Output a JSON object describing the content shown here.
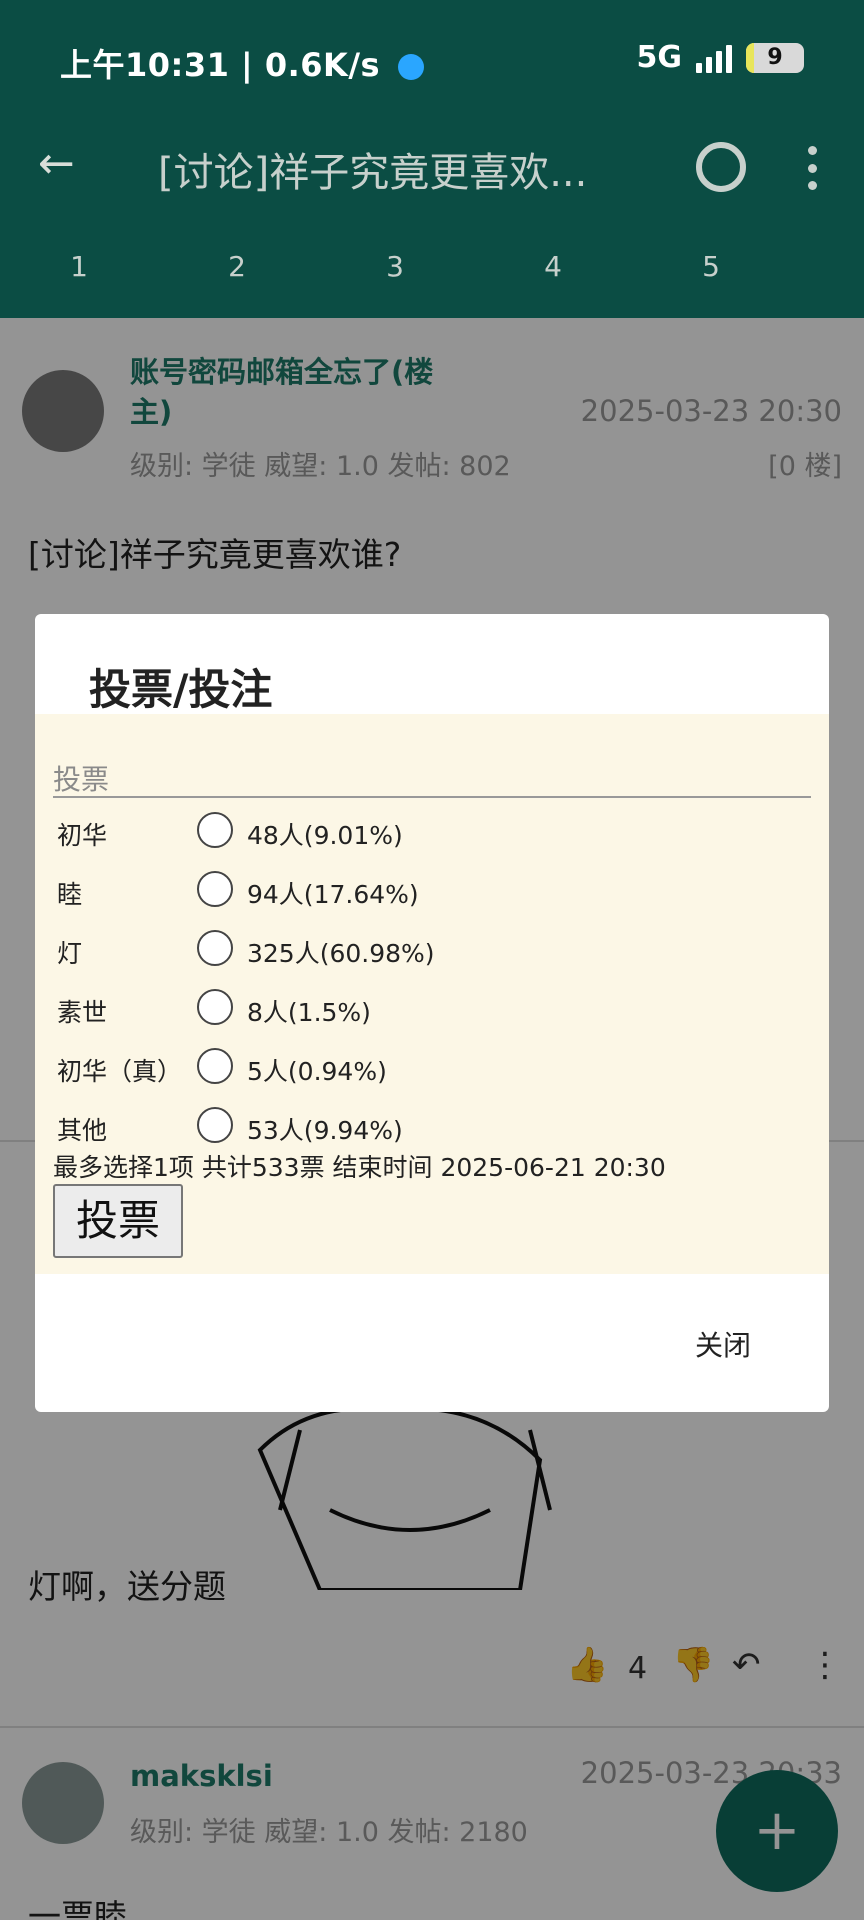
{
  "status": {
    "time": "上午10:31 | 0.6K/s",
    "network": "5G",
    "battery": "9"
  },
  "app_bar": {
    "title": "[讨论]祥子究竟更喜欢...",
    "tabs": [
      "1",
      "2",
      "3",
      "4",
      "5"
    ]
  },
  "post1": {
    "author": "账号密码邮箱全忘了(楼主)",
    "date": "2025-03-23 20:30",
    "meta": "级别: 学徒   威望: 1.0   发帖: 802",
    "floor": "[0 楼]",
    "title": "[讨论]祥子究竟更喜欢谁?"
  },
  "post2": {
    "reply": "灯啊，送分题",
    "likes": "4"
  },
  "post3": {
    "author": "maksklsi",
    "date": "2025-03-23 20:33",
    "meta": "级别: 学徒   威望: 1.0   发帖: 2180",
    "reply": "一票睦"
  },
  "dialog": {
    "title": "投票/投注",
    "legend": "投票",
    "options": [
      {
        "name": "初华",
        "count": "48人(9.01%)"
      },
      {
        "name": "睦",
        "count": "94人(17.64%)"
      },
      {
        "name": "灯",
        "count": "325人(60.98%)"
      },
      {
        "name": "素世",
        "count": "8人(1.5%)"
      },
      {
        "name": "初华（真）",
        "count": "5人(0.94%)"
      },
      {
        "name": "其他",
        "count": "53人(9.94%)"
      }
    ],
    "summary": "最多选择1项 共计533票 结束时间 2025-06-21 20:30",
    "vote_label": "投票",
    "close_label": "关闭"
  },
  "fab": {
    "label": "+"
  },
  "colors": {
    "primary": "#0b4d44",
    "accent": "#1e7a6a",
    "panel": "#fcf7e6"
  }
}
